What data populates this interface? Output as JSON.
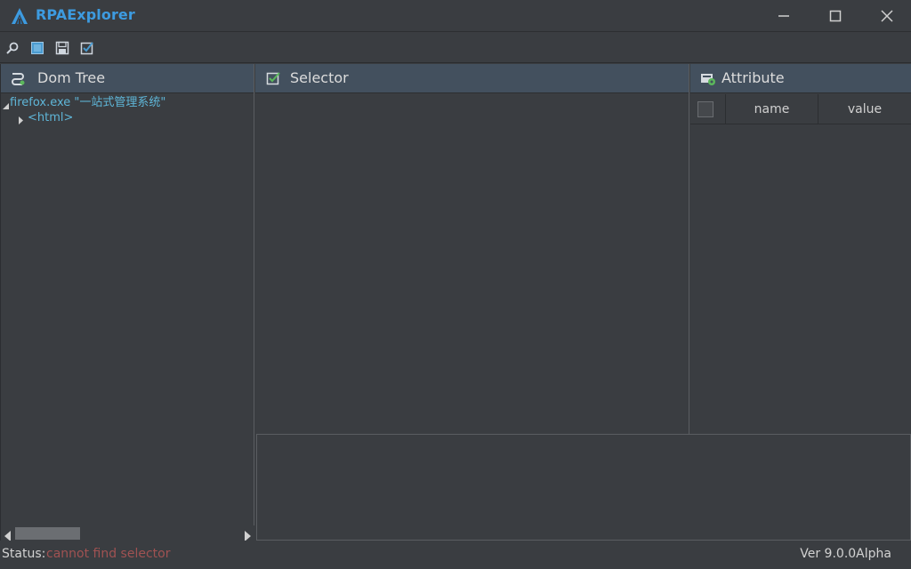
{
  "app": {
    "title": "RPAExplorer",
    "accent_color": "#3d9be0",
    "logo_icon": "rpa-logo-icon"
  },
  "window_controls": {
    "minimize_icon": "minimize-icon",
    "maximize_icon": "maximize-icon",
    "close_icon": "close-icon"
  },
  "toolbar": {
    "items": [
      {
        "name": "search",
        "icon": "magnifier-icon"
      },
      {
        "name": "highlight",
        "icon": "square-icon"
      },
      {
        "name": "save",
        "icon": "floppy-icon"
      },
      {
        "name": "validate",
        "icon": "check-edit-icon"
      }
    ]
  },
  "dom_tree": {
    "title": "Dom Tree",
    "icon": "tree-icon",
    "nodes": [
      {
        "label": "firefox.exe \"一站式管理系统\"",
        "expanded": true,
        "level": 0
      },
      {
        "label": "<html>",
        "expanded": false,
        "level": 1
      }
    ]
  },
  "selector": {
    "title": "Selector",
    "icon": "selector-check-icon"
  },
  "attribute": {
    "title": "Attribute",
    "icon": "attribute-gear-icon",
    "columns": [
      "name",
      "value"
    ],
    "rows": []
  },
  "status": {
    "label": "Status:",
    "message": "cannot find selector",
    "message_color": "#a05252",
    "version": "Ver 9.0.0Alpha"
  }
}
